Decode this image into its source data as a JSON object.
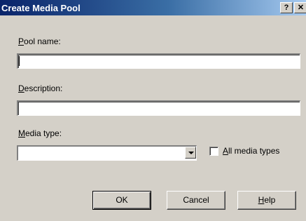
{
  "dialog": {
    "title": "Create Media Pool",
    "help_glyph": "?",
    "close_glyph": "✕"
  },
  "form": {
    "pool_name_label_acc": "P",
    "pool_name_label_rest": "ool name:",
    "pool_name_value": "",
    "description_label_acc": "D",
    "description_label_rest": "escription:",
    "description_value": "",
    "media_type_label_acc": "M",
    "media_type_label_rest": "edia type:",
    "media_type_value": "",
    "all_media_types_acc": "A",
    "all_media_types_rest": "ll media types",
    "all_media_types_checked": false
  },
  "buttons": {
    "ok": "OK",
    "cancel": "Cancel",
    "help_acc": "H",
    "help_rest": "elp"
  }
}
